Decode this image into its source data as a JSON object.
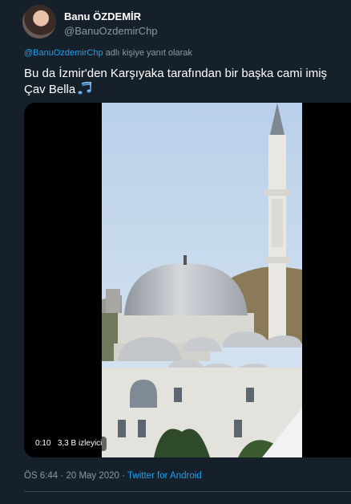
{
  "user": {
    "display_name": "Banu ÖZDEMİR",
    "handle": "@BanuOzdemirChp"
  },
  "reply": {
    "handle": "@BanuOzdemirChp",
    "suffix": "adlı kişiye yanıt olarak"
  },
  "tweet": {
    "line1": "Bu da İzmir'den Karşıyaka tarafından bir başka cami imiş",
    "line2": "Çav Bella",
    "emoji_icon": "musical-notes-icon"
  },
  "video": {
    "elapsed": "0:10",
    "views": "3,3 B izleyici"
  },
  "meta": {
    "time": "ÖS 6:44",
    "separator": "·",
    "date": "20 May 2020",
    "source": "Twitter for Android"
  },
  "colors": {
    "background": "#15202b",
    "link": "#1da1f2",
    "muted": "#8899a6"
  }
}
